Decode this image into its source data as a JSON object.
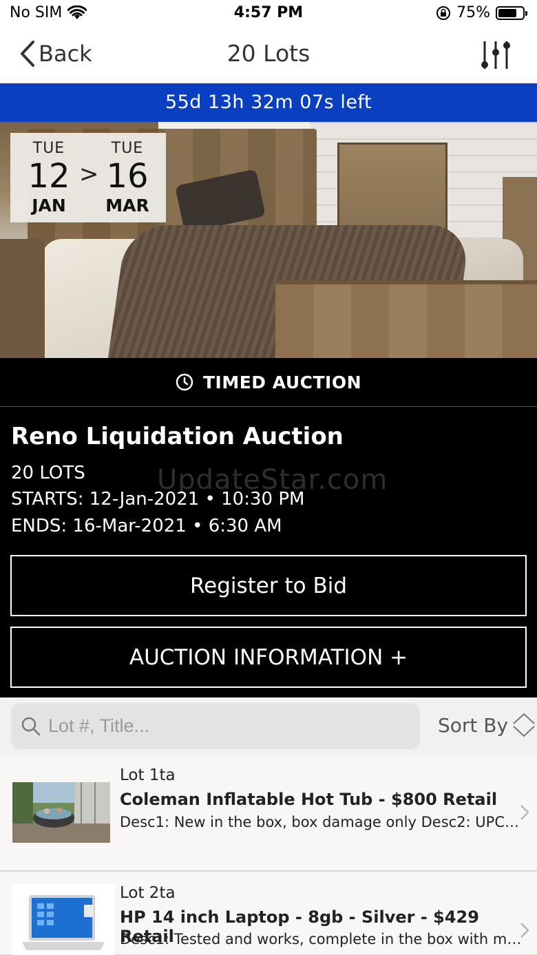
{
  "status_bar": {
    "carrier": "No SIM",
    "time": "4:57 PM",
    "battery": "75%",
    "battery_level": 0.75
  },
  "nav": {
    "back_label": "Back",
    "title": "20 Lots"
  },
  "countdown": "55d 13h 32m 07s left",
  "date_range": {
    "start": {
      "dow": "TUE",
      "day": "12",
      "month": "JAN"
    },
    "arrow": ">",
    "end": {
      "dow": "TUE",
      "day": "16",
      "month": "MAR"
    }
  },
  "auction": {
    "type_label": "TIMED AUCTION",
    "title": "Reno Liquidation Auction",
    "lots": "20 LOTS",
    "starts": "STARTS: 12-Jan-2021 • 10:30 PM",
    "ends": "ENDS: 16-Mar-2021 • 6:30 AM",
    "register_label": "Register to Bid",
    "info_label": "AUCTION INFORMATION +"
  },
  "watermark": "UpdateStar.com",
  "search": {
    "placeholder": "Lot #, Title...",
    "sort_label": "Sort By"
  },
  "lots": [
    {
      "number": "Lot 1ta",
      "title": "Coleman Inflatable Hot Tub - $800 Retail",
      "desc": "Desc1: New in the box, box damage only Desc2: UPC c..."
    },
    {
      "number": "Lot 2ta",
      "title": "HP 14 inch Laptop - 8gb - Silver - $429 Retail",
      "desc": "Desc1: Tested and works, complete in the box with man..."
    }
  ],
  "colors": {
    "countdown_bg": "#0b3fc1",
    "panel_bg": "#000000"
  }
}
